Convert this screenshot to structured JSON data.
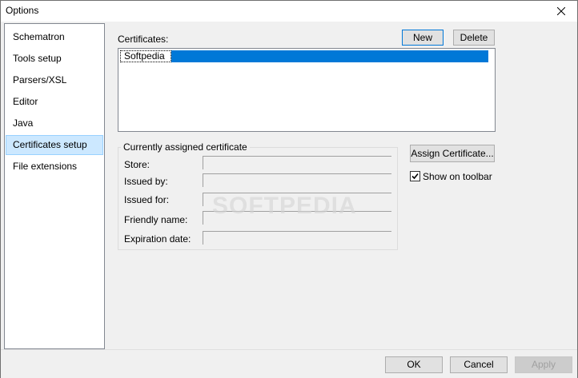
{
  "window": {
    "title": "Options"
  },
  "nav": {
    "items": [
      {
        "label": "Schematron"
      },
      {
        "label": "Tools setup"
      },
      {
        "label": "Parsers/XSL"
      },
      {
        "label": "Editor"
      },
      {
        "label": "Java"
      },
      {
        "label": "Certificates setup",
        "selected": true
      },
      {
        "label": "File extensions"
      }
    ]
  },
  "certificates": {
    "label": "Certificates:",
    "new_label": "New",
    "delete_label": "Delete",
    "items": [
      "Softpedia"
    ]
  },
  "assigned": {
    "legend": "Currently assigned certificate",
    "fields": {
      "store": {
        "label": "Store:",
        "value": ""
      },
      "issued_by": {
        "label": "Issued by:",
        "value": ""
      },
      "issued_for": {
        "label": "Issued for:",
        "value": ""
      },
      "friendly_name": {
        "label": "Friendly name:",
        "value": ""
      },
      "expiration_date": {
        "label": "Expiration date:",
        "value": ""
      }
    },
    "assign_label": "Assign Certificate...",
    "show_toolbar_label": "Show on toolbar",
    "show_toolbar_checked": true
  },
  "watermark": "SOFTPEDIA",
  "footer": {
    "ok_label": "OK",
    "cancel_label": "Cancel",
    "apply_label": "Apply"
  },
  "colors": {
    "selection": "#0078d7",
    "nav_selected": "#cce8ff"
  }
}
